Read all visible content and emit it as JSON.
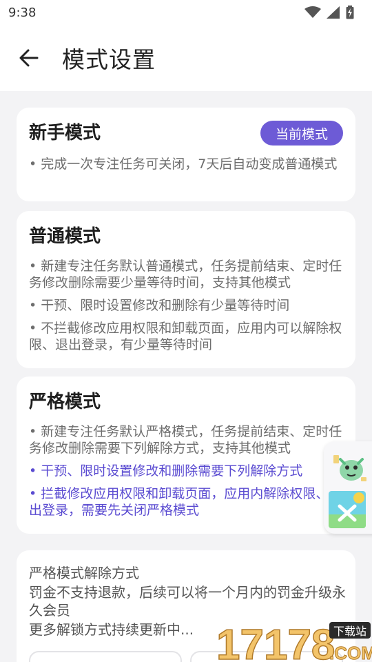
{
  "status_bar": {
    "time": "9:38"
  },
  "header": {
    "title": "模式设置"
  },
  "modes": {
    "novice": {
      "title": "新手模式",
      "badge": "当前模式",
      "bullets": [
        "• 完成一次专注任务可关闭，7天后自动变成普通模式"
      ]
    },
    "normal": {
      "title": "普通模式",
      "bullets": [
        "• 新建专注任务默认普通模式，任务提前结束、定时任务修改删除需要少量等待时间，支持其他模式",
        "• 干预、限时设置修改和删除有少量等待时间",
        "• 不拦截修改应用权限和卸载页面，应用内可以解除权限、退出登录，有少量等待时间"
      ]
    },
    "strict": {
      "title": "严格模式",
      "bullets": [
        "• 新建专注任务默认严格模式，任务提前结束、定时任务修改删除需要下列解除方式，支持其他模式",
        "• 干预、限时设置修改和删除需要下列解除方式",
        "• 拦截修改应用权限和卸载页面，应用内解除权限、退出登录，需要先关闭严格模式"
      ]
    }
  },
  "unlock": {
    "title": "严格模式解除方式",
    "text": "罚金不支持退款，后续可以将一个月内的罚金升级永久会员",
    "more": "更多解锁方式持续更新中..."
  },
  "watermark": {
    "number": "17178",
    "tag": "下载站",
    "suffix": ".COM"
  },
  "colors": {
    "accent": "#6d5bd6",
    "accent_text": "#5a4bd1",
    "background": "#f3f3f5",
    "card": "#ffffff"
  }
}
